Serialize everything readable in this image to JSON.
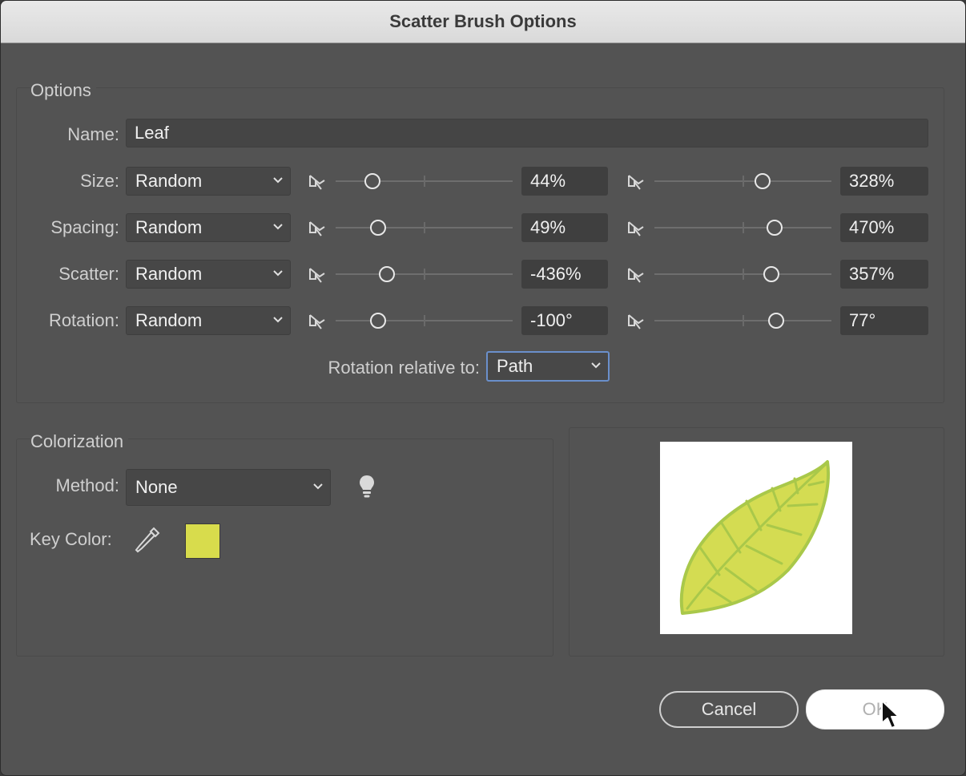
{
  "window": {
    "title": "Scatter Brush Options"
  },
  "options": {
    "title": "Options",
    "name_label": "Name:",
    "name_value": "Leaf",
    "rows": [
      {
        "label": "Size:",
        "method": "Random",
        "min_value": "44%",
        "max_value": "328%",
        "min_slider": 0.21,
        "max_slider": 0.61
      },
      {
        "label": "Spacing:",
        "method": "Random",
        "min_value": "49%",
        "max_value": "470%",
        "min_slider": 0.24,
        "max_slider": 0.68
      },
      {
        "label": "Scatter:",
        "method": "Random",
        "min_value": "-436%",
        "max_value": "357%",
        "min_slider": 0.29,
        "max_slider": 0.66
      },
      {
        "label": "Rotation:",
        "method": "Random",
        "min_value": "-100°",
        "max_value": "77°",
        "min_slider": 0.24,
        "max_slider": 0.69
      }
    ],
    "rotation_relative_label": "Rotation relative to:",
    "rotation_relative_value": "Path"
  },
  "colorization": {
    "title": "Colorization",
    "method_label": "Method:",
    "method_value": "None",
    "key_color_label": "Key Color:",
    "key_color": "#d8dc4c"
  },
  "preview": {
    "leaf_color": "#d4dc52",
    "leaf_vein_color": "#a9c84a"
  },
  "buttons": {
    "cancel": "Cancel",
    "ok": "OK"
  }
}
